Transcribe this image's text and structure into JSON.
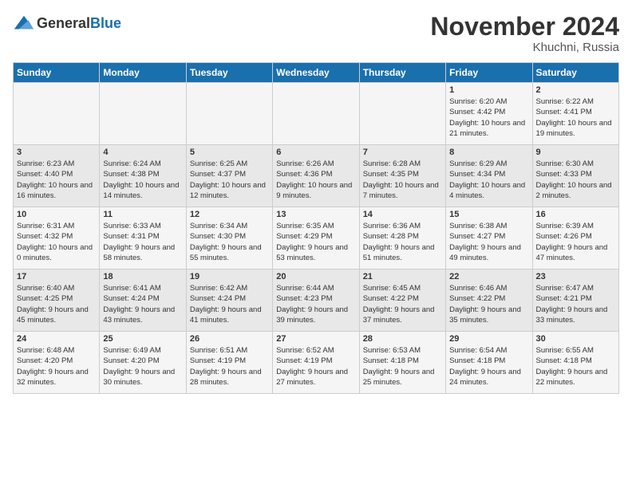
{
  "header": {
    "logo_general": "General",
    "logo_blue": "Blue",
    "month_title": "November 2024",
    "location": "Khuchni, Russia"
  },
  "days_of_week": [
    "Sunday",
    "Monday",
    "Tuesday",
    "Wednesday",
    "Thursday",
    "Friday",
    "Saturday"
  ],
  "weeks": [
    [
      {
        "day": "",
        "info": ""
      },
      {
        "day": "",
        "info": ""
      },
      {
        "day": "",
        "info": ""
      },
      {
        "day": "",
        "info": ""
      },
      {
        "day": "",
        "info": ""
      },
      {
        "day": "1",
        "info": "Sunrise: 6:20 AM\nSunset: 4:42 PM\nDaylight: 10 hours and 21 minutes."
      },
      {
        "day": "2",
        "info": "Sunrise: 6:22 AM\nSunset: 4:41 PM\nDaylight: 10 hours and 19 minutes."
      }
    ],
    [
      {
        "day": "3",
        "info": "Sunrise: 6:23 AM\nSunset: 4:40 PM\nDaylight: 10 hours and 16 minutes."
      },
      {
        "day": "4",
        "info": "Sunrise: 6:24 AM\nSunset: 4:38 PM\nDaylight: 10 hours and 14 minutes."
      },
      {
        "day": "5",
        "info": "Sunrise: 6:25 AM\nSunset: 4:37 PM\nDaylight: 10 hours and 12 minutes."
      },
      {
        "day": "6",
        "info": "Sunrise: 6:26 AM\nSunset: 4:36 PM\nDaylight: 10 hours and 9 minutes."
      },
      {
        "day": "7",
        "info": "Sunrise: 6:28 AM\nSunset: 4:35 PM\nDaylight: 10 hours and 7 minutes."
      },
      {
        "day": "8",
        "info": "Sunrise: 6:29 AM\nSunset: 4:34 PM\nDaylight: 10 hours and 4 minutes."
      },
      {
        "day": "9",
        "info": "Sunrise: 6:30 AM\nSunset: 4:33 PM\nDaylight: 10 hours and 2 minutes."
      }
    ],
    [
      {
        "day": "10",
        "info": "Sunrise: 6:31 AM\nSunset: 4:32 PM\nDaylight: 10 hours and 0 minutes."
      },
      {
        "day": "11",
        "info": "Sunrise: 6:33 AM\nSunset: 4:31 PM\nDaylight: 9 hours and 58 minutes."
      },
      {
        "day": "12",
        "info": "Sunrise: 6:34 AM\nSunset: 4:30 PM\nDaylight: 9 hours and 55 minutes."
      },
      {
        "day": "13",
        "info": "Sunrise: 6:35 AM\nSunset: 4:29 PM\nDaylight: 9 hours and 53 minutes."
      },
      {
        "day": "14",
        "info": "Sunrise: 6:36 AM\nSunset: 4:28 PM\nDaylight: 9 hours and 51 minutes."
      },
      {
        "day": "15",
        "info": "Sunrise: 6:38 AM\nSunset: 4:27 PM\nDaylight: 9 hours and 49 minutes."
      },
      {
        "day": "16",
        "info": "Sunrise: 6:39 AM\nSunset: 4:26 PM\nDaylight: 9 hours and 47 minutes."
      }
    ],
    [
      {
        "day": "17",
        "info": "Sunrise: 6:40 AM\nSunset: 4:25 PM\nDaylight: 9 hours and 45 minutes."
      },
      {
        "day": "18",
        "info": "Sunrise: 6:41 AM\nSunset: 4:24 PM\nDaylight: 9 hours and 43 minutes."
      },
      {
        "day": "19",
        "info": "Sunrise: 6:42 AM\nSunset: 4:24 PM\nDaylight: 9 hours and 41 minutes."
      },
      {
        "day": "20",
        "info": "Sunrise: 6:44 AM\nSunset: 4:23 PM\nDaylight: 9 hours and 39 minutes."
      },
      {
        "day": "21",
        "info": "Sunrise: 6:45 AM\nSunset: 4:22 PM\nDaylight: 9 hours and 37 minutes."
      },
      {
        "day": "22",
        "info": "Sunrise: 6:46 AM\nSunset: 4:22 PM\nDaylight: 9 hours and 35 minutes."
      },
      {
        "day": "23",
        "info": "Sunrise: 6:47 AM\nSunset: 4:21 PM\nDaylight: 9 hours and 33 minutes."
      }
    ],
    [
      {
        "day": "24",
        "info": "Sunrise: 6:48 AM\nSunset: 4:20 PM\nDaylight: 9 hours and 32 minutes."
      },
      {
        "day": "25",
        "info": "Sunrise: 6:49 AM\nSunset: 4:20 PM\nDaylight: 9 hours and 30 minutes."
      },
      {
        "day": "26",
        "info": "Sunrise: 6:51 AM\nSunset: 4:19 PM\nDaylight: 9 hours and 28 minutes."
      },
      {
        "day": "27",
        "info": "Sunrise: 6:52 AM\nSunset: 4:19 PM\nDaylight: 9 hours and 27 minutes."
      },
      {
        "day": "28",
        "info": "Sunrise: 6:53 AM\nSunset: 4:18 PM\nDaylight: 9 hours and 25 minutes."
      },
      {
        "day": "29",
        "info": "Sunrise: 6:54 AM\nSunset: 4:18 PM\nDaylight: 9 hours and 24 minutes."
      },
      {
        "day": "30",
        "info": "Sunrise: 6:55 AM\nSunset: 4:18 PM\nDaylight: 9 hours and 22 minutes."
      }
    ]
  ]
}
